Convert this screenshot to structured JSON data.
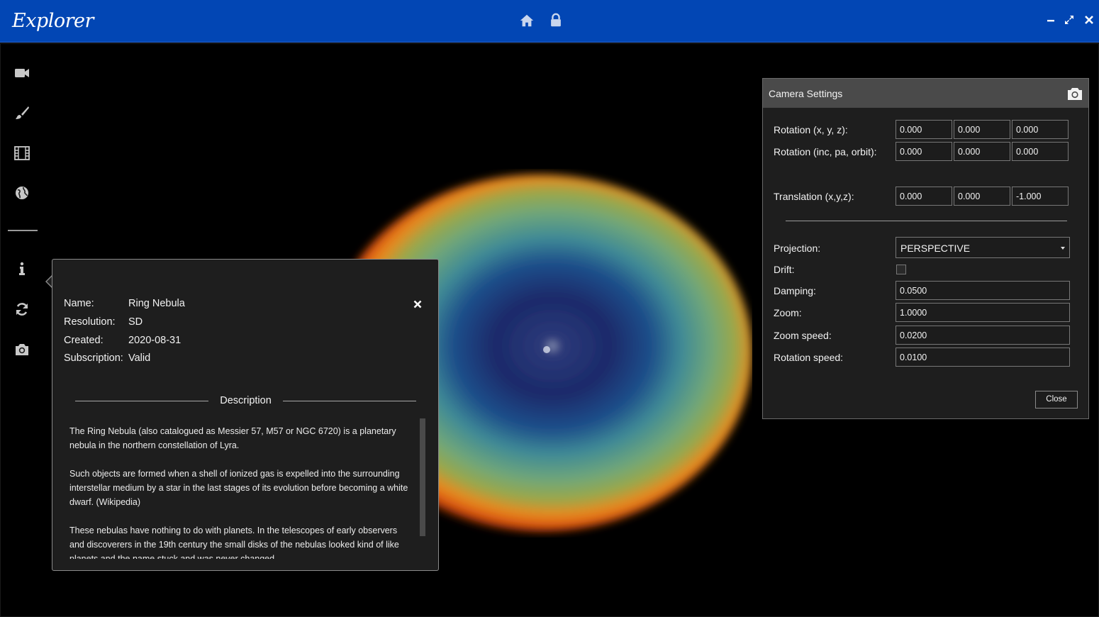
{
  "app": {
    "title": "Explorer"
  },
  "colors": {
    "titlebar": "#0246b4",
    "panel_bg": "#1e1e1e",
    "panel_header": "#4a4a4a"
  },
  "titlebar": {
    "center_icons": [
      "home-icon",
      "lock-icon"
    ],
    "window_controls": [
      "minimize-icon",
      "maximize-icon",
      "close-icon"
    ]
  },
  "sidebar": {
    "items": [
      "video-camera-icon",
      "brush-icon",
      "film-icon",
      "globe-icon",
      "info-icon",
      "refresh-icon",
      "camera-icon"
    ]
  },
  "info_panel": {
    "fields": [
      {
        "label": "Name:",
        "value": "Ring Nebula"
      },
      {
        "label": "Resolution:",
        "value": "SD"
      },
      {
        "label": "Created:",
        "value": "2020-08-31"
      },
      {
        "label": "Subscription:",
        "value": "Valid"
      }
    ],
    "description_title": "Description",
    "description": [
      "The Ring Nebula (also catalogued as Messier 57, M57 or NGC 6720) is a planetary nebula in the northern constellation of Lyra.",
      "Such objects are formed when a shell of ionized gas is expelled into the surrounding interstellar medium by a star in the last stages of its evolution before becoming a white dwarf. (Wikipedia)",
      "These nebulas have nothing to do with planets. In the telescopes of early observers and discoverers in the 19th century the small disks of the nebulas looked kind of like planets and the name stuck and was never changed."
    ]
  },
  "camera_settings": {
    "title": "Camera Settings",
    "rotation_xyz": {
      "label": "Rotation (x, y, z):",
      "values": [
        "0.000",
        "0.000",
        "0.000"
      ]
    },
    "rotation_inc": {
      "label": "Rotation (inc, pa, orbit):",
      "values": [
        "0.000",
        "0.000",
        "0.000"
      ]
    },
    "translation": {
      "label": "Translation (x,y,z):",
      "values": [
        "0.000",
        "0.000",
        "-1.000"
      ]
    },
    "projection": {
      "label": "Projection:",
      "value": "PERSPECTIVE"
    },
    "drift": {
      "label": "Drift:",
      "checked": false
    },
    "damping": {
      "label": "Damping:",
      "value": "0.0500"
    },
    "zoom": {
      "label": "Zoom:",
      "value": "1.0000"
    },
    "zoom_speed": {
      "label": "Zoom speed:",
      "value": "0.0200"
    },
    "rotation_speed": {
      "label": "Rotation speed:",
      "value": "0.0100"
    },
    "close_label": "Close"
  }
}
